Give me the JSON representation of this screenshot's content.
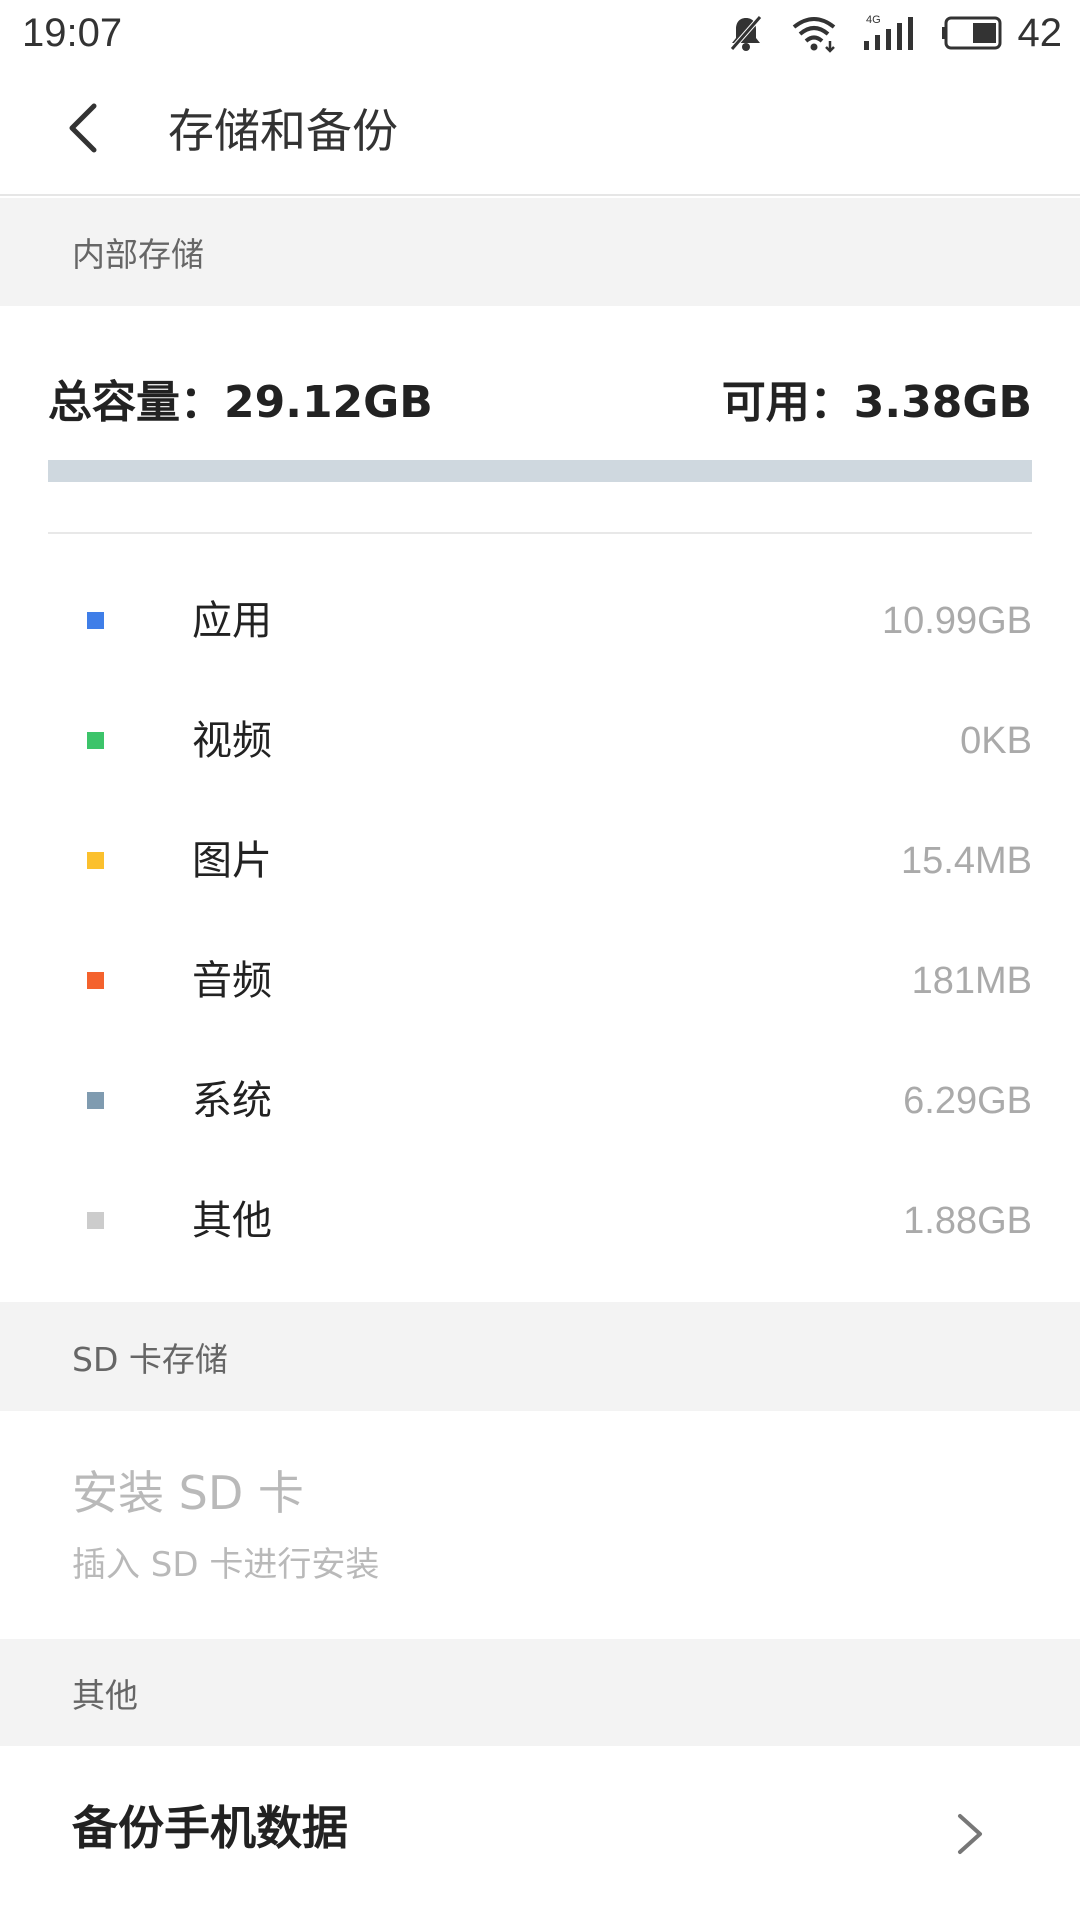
{
  "status_bar": {
    "time": "19:07",
    "battery": "42",
    "network_label": "4G",
    "icons": [
      "silent-bell-icon",
      "wifi-icon",
      "cellular-signal-icon",
      "battery-icon"
    ]
  },
  "app_bar": {
    "title": "存储和备份",
    "back_icon": "chevron-left-icon"
  },
  "internal": {
    "header": "内部存储",
    "total_label": "总容量：29.12GB",
    "available_label": "可用：3.38GB",
    "used_fraction": 0.0,
    "items": [
      {
        "label": "应用",
        "value": "10.99GB",
        "color": "#3f7ee8"
      },
      {
        "label": "视频",
        "value": "0KB",
        "color": "#3cc46a"
      },
      {
        "label": "图片",
        "value": "15.4MB",
        "color": "#fbc02d"
      },
      {
        "label": "音频",
        "value": "181MB",
        "color": "#f4622d"
      },
      {
        "label": "系统",
        "value": "6.29GB",
        "color": "#7f9bb0"
      },
      {
        "label": "其他",
        "value": "1.88GB",
        "color": "#cccccc"
      }
    ]
  },
  "sd": {
    "header": "SD 卡存储",
    "title": "安装 SD 卡",
    "subtitle": "插入 SD 卡进行安装"
  },
  "other": {
    "header": "其他",
    "backup_label": "备份手机数据",
    "chevron_icon": "chevron-right-icon"
  },
  "colors": {
    "section_bg": "#f3f3f3",
    "usage_track": "#cfd8df",
    "muted_text": "#aaaaaa"
  }
}
